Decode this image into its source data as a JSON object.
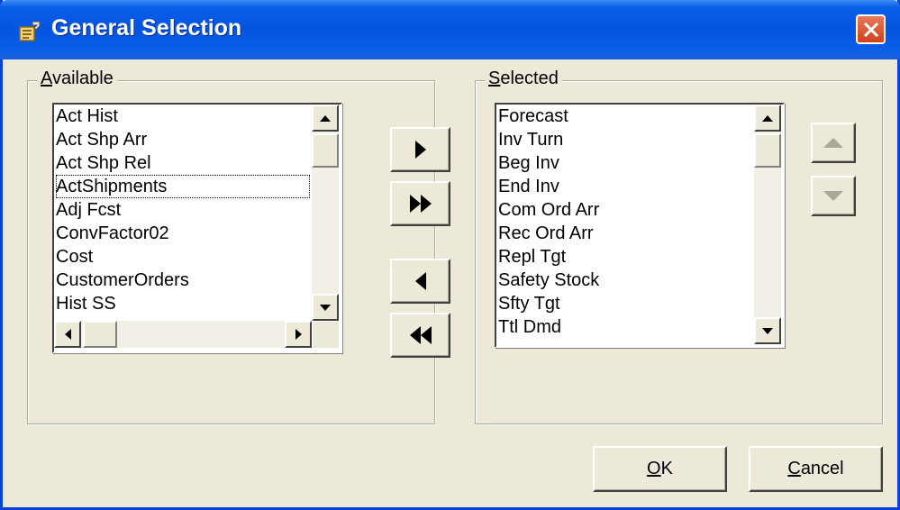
{
  "window": {
    "title": "General Selection",
    "icon": "properties-icon"
  },
  "available": {
    "label_accel": "A",
    "label_rest": "vailable",
    "items": [
      "Act Hist",
      "Act Shp Arr",
      "Act Shp Rel",
      "ActShipments",
      "Adj Fcst",
      "ConvFactor02",
      "Cost",
      "CustomerOrders",
      "Hist SS"
    ],
    "focused_index": 3
  },
  "selected": {
    "label_accel": "S",
    "label_rest": "elected",
    "items": [
      "Forecast",
      "Inv Turn",
      "Beg Inv",
      "End Inv",
      "Com Ord Arr",
      "Rec Ord Arr",
      "Repl Tgt",
      "Safety Stock",
      "Sfty Tgt",
      "Ttl Dmd"
    ]
  },
  "transfer_buttons": {
    "add": "triangle-right-icon",
    "add_all": "double-triangle-right-icon",
    "remove": "triangle-left-icon",
    "remove_all": "double-triangle-left-icon"
  },
  "order_buttons": {
    "up": "triangle-up-icon",
    "down": "triangle-down-icon",
    "enabled": false
  },
  "footer": {
    "ok_accel": "O",
    "ok_rest": "K",
    "cancel_accel": "C",
    "cancel_rest": "ancel"
  },
  "colors": {
    "title_bar": "#0554e2",
    "dialog_face": "#ece9d8",
    "close_button": "#d0401c"
  }
}
